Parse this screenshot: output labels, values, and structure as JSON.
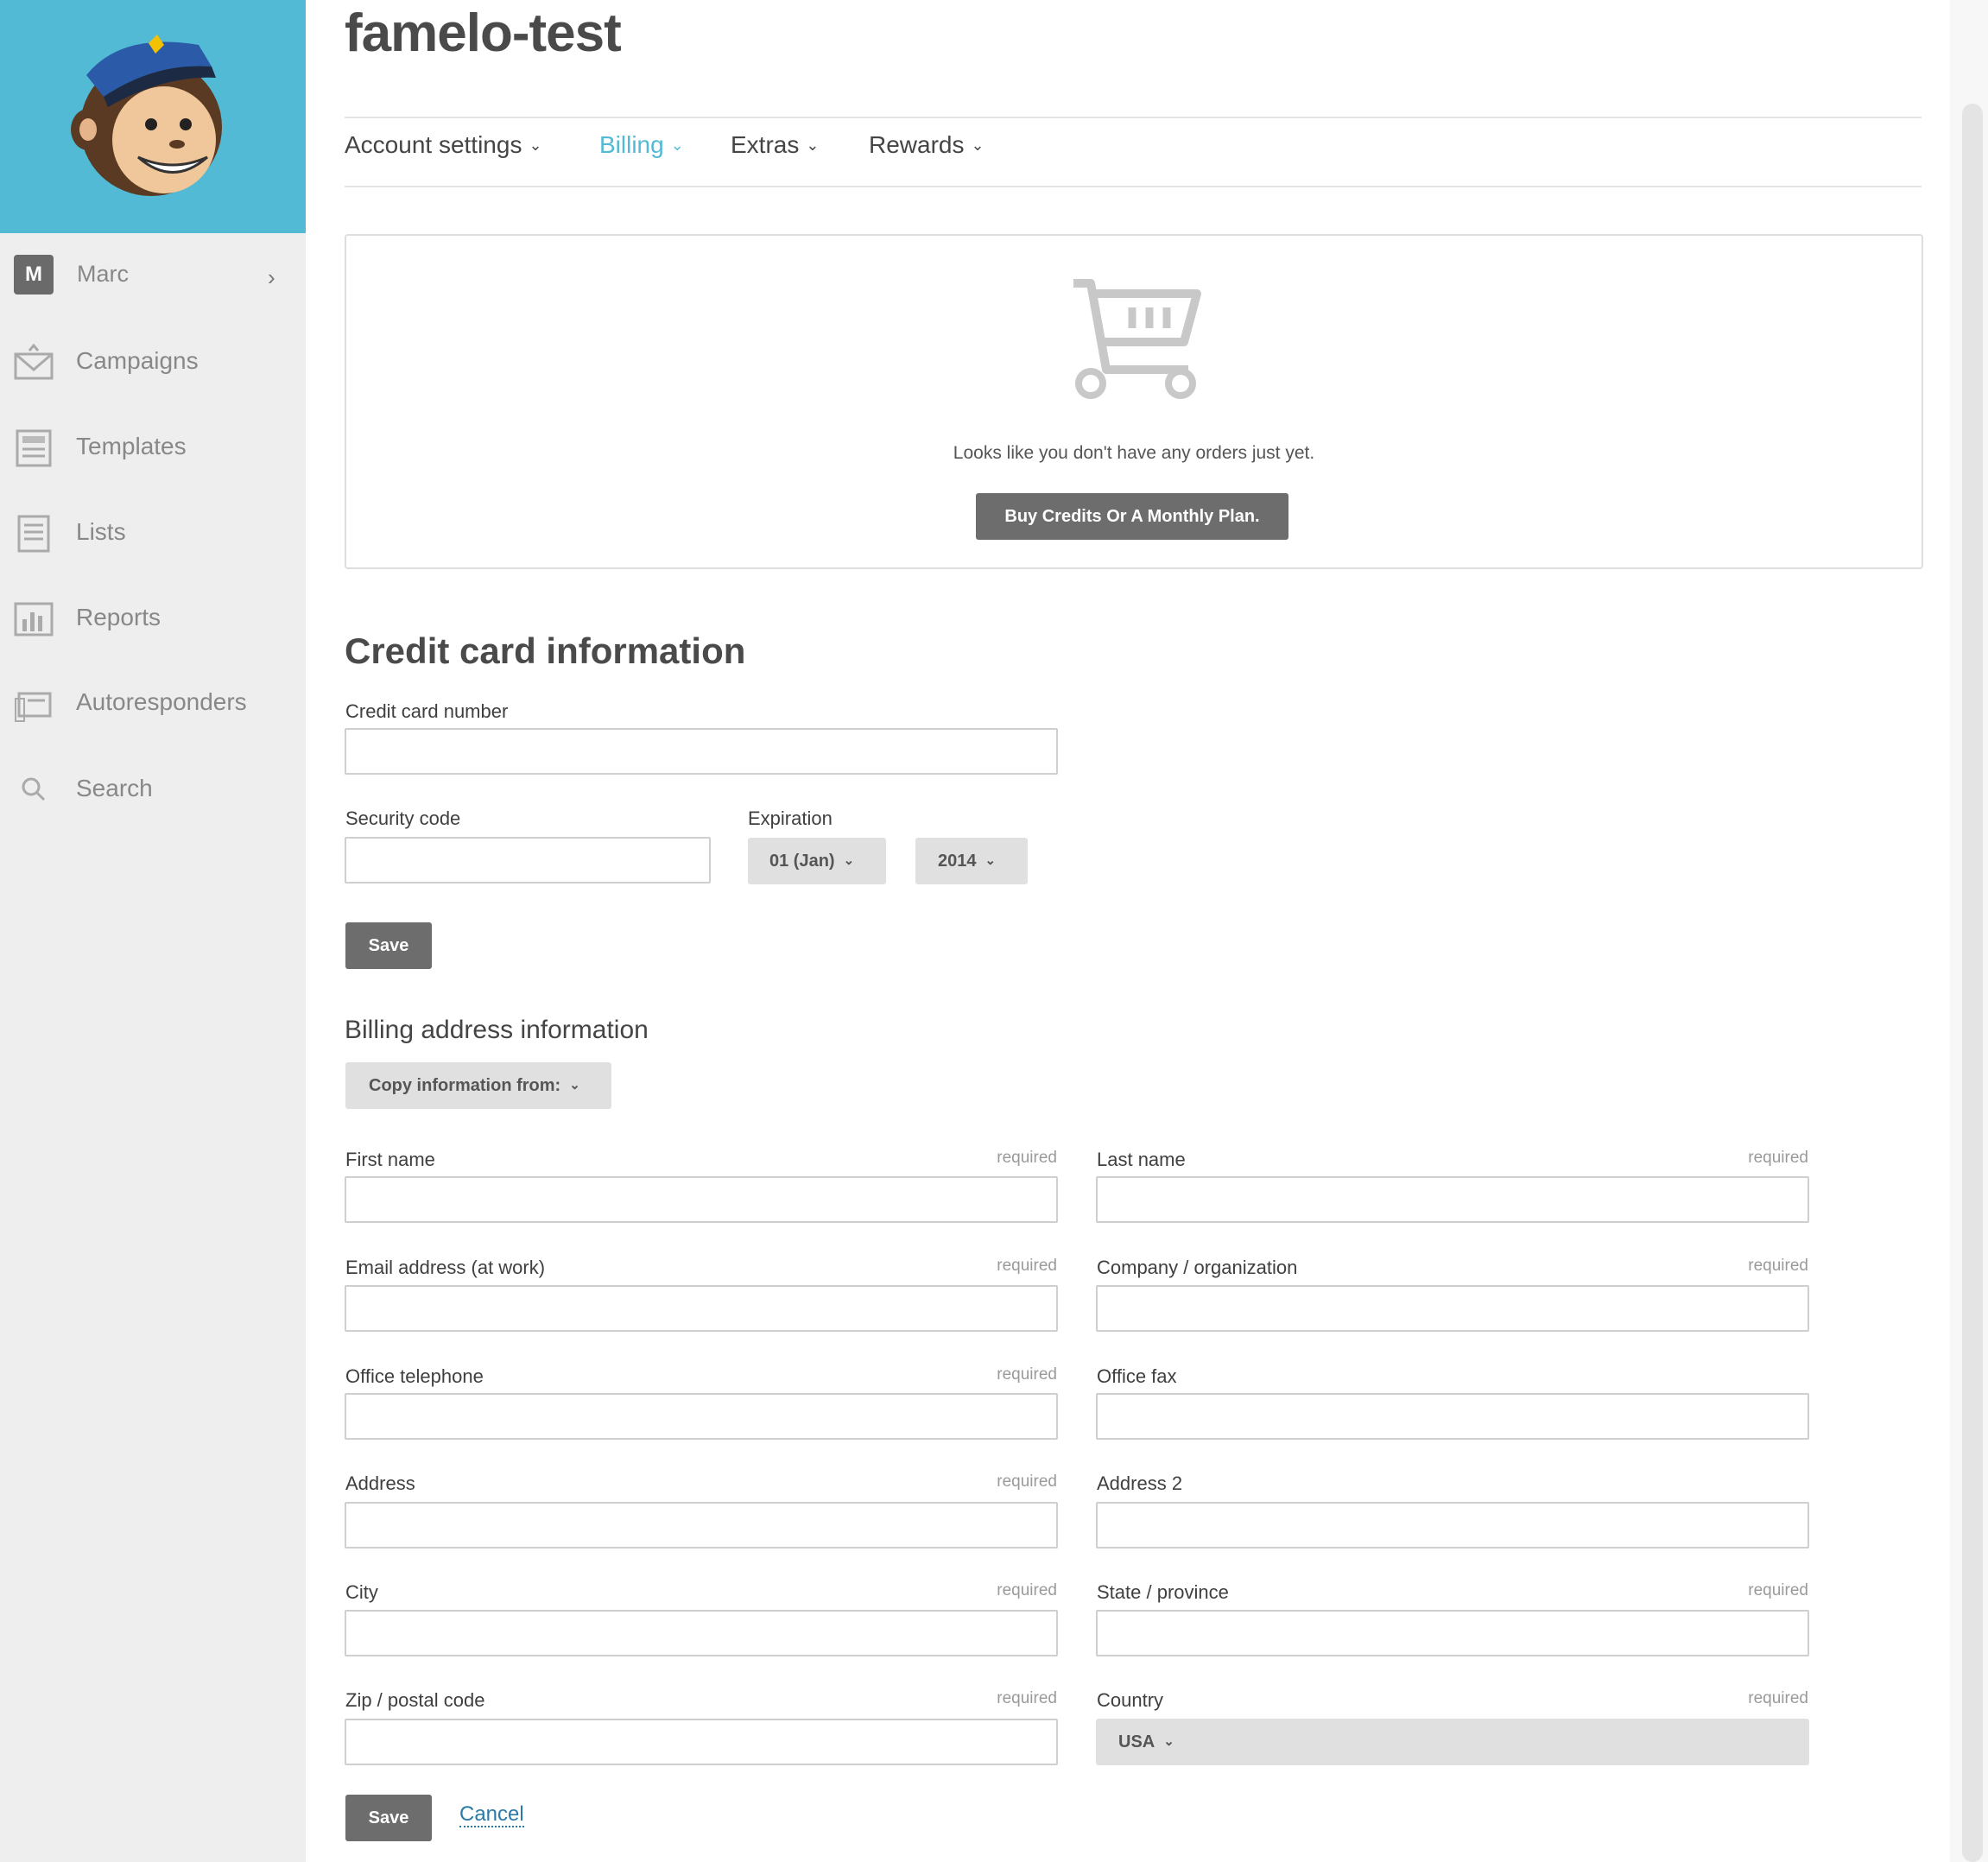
{
  "account_name": "famelo-test",
  "sidebar": {
    "user": {
      "initial": "M",
      "name": "Marc"
    },
    "items": [
      {
        "label": "Campaigns",
        "icon": "envelope-icon"
      },
      {
        "label": "Templates",
        "icon": "template-icon"
      },
      {
        "label": "Lists",
        "icon": "list-icon"
      },
      {
        "label": "Reports",
        "icon": "bar-chart-icon"
      },
      {
        "label": "Autoresponders",
        "icon": "autoresponder-icon"
      },
      {
        "label": "Search",
        "icon": "search-icon"
      }
    ]
  },
  "tabs": [
    {
      "label": "Account settings",
      "active": false
    },
    {
      "label": "Billing",
      "active": true
    },
    {
      "label": "Extras",
      "active": false
    },
    {
      "label": "Rewards",
      "active": false
    }
  ],
  "orders": {
    "empty_message": "Looks like you don't have any orders just yet.",
    "buy_button": "Buy Credits Or A Monthly Plan."
  },
  "credit_card": {
    "title": "Credit card information",
    "number_label": "Credit card number",
    "security_label": "Security code",
    "expiration_label": "Expiration",
    "month_value": "01 (Jan)",
    "year_value": "2014",
    "save_label": "Save"
  },
  "billing": {
    "title": "Billing address information",
    "copy_label": "Copy information from:",
    "required_text": "required",
    "fields": {
      "first_name": "First name",
      "last_name": "Last name",
      "email": "Email address (at work)",
      "company": "Company / organization",
      "phone": "Office telephone",
      "fax": "Office fax",
      "address": "Address",
      "address2": "Address 2",
      "city": "City",
      "state": "State / province",
      "zip": "Zip / postal code",
      "country": "Country"
    },
    "country_value": "USA",
    "save_label": "Save",
    "cancel_label": "Cancel"
  },
  "colors": {
    "accent": "#52bad5",
    "button": "#6d6d6d",
    "sidebar": "#eeeeee"
  }
}
